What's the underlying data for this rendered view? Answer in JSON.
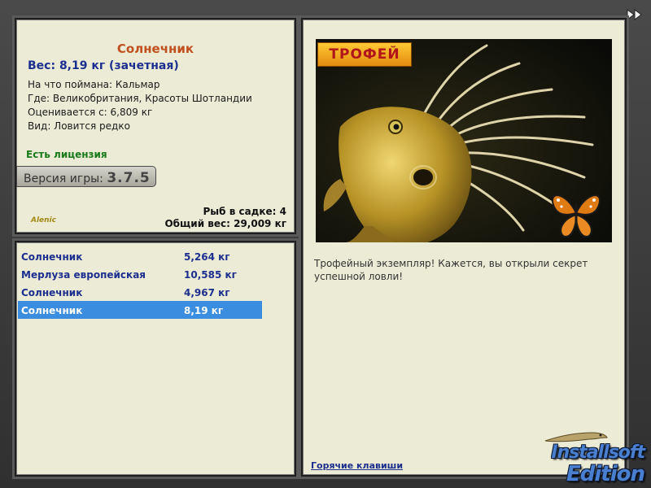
{
  "catch": {
    "title": "Солнечник",
    "weight_line": "Вес: 8,19 кг (зачетная)",
    "details": [
      "На что поймана: Кальмар",
      "Где: Великобритания, Красоты Шотландии",
      "Оценивается с: 6,809 кг",
      "Вид: Ловится редко"
    ],
    "license": "Есть лицензия",
    "version_label": "Версия игры:",
    "version_number": "3.7.5",
    "fish_in_keepnet": "Рыб в садке: 4",
    "total_weight": "Общий вес: 29,009 кг",
    "mini_logo": "Alenic"
  },
  "catch_list": {
    "rows": [
      {
        "name": "Солнечник",
        "weight": "5,264 кг"
      },
      {
        "name": "Мерлуза европейская",
        "weight": "10,585 кг"
      },
      {
        "name": "Солнечник",
        "weight": "4,967 кг"
      },
      {
        "name": "Солнечник",
        "weight": "8,19 кг"
      }
    ],
    "selected_index": 3
  },
  "detail": {
    "trophy_badge": "ТРОФЕЙ",
    "message": "Трофейный экземпляр! Кажется, вы открыли секрет успешной ловли!",
    "hotkeys_link": "Горячие клавиши"
  },
  "nav": {
    "next_icon": "double-chevron-right-icon"
  },
  "watermark": {
    "line1": "Installsoft",
    "line2": "Edition"
  },
  "colors": {
    "panel_bg": "#ecebd6",
    "title": "#c0501e",
    "link_blue": "#1c2f8e",
    "license_green": "#1a7a1a",
    "selection": "#3b8de0"
  }
}
